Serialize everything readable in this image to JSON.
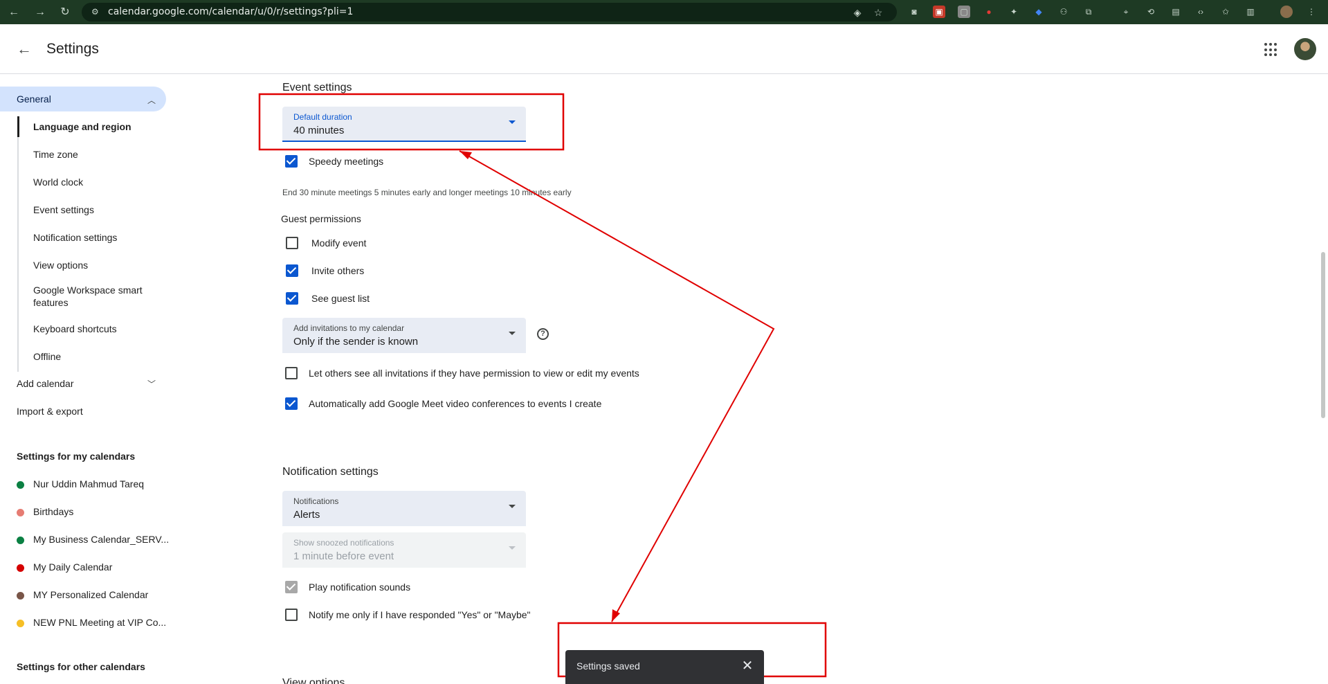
{
  "browser": {
    "url": "calendar.google.com/calendar/u/0/r/settings?pli=1"
  },
  "header": {
    "title": "Settings"
  },
  "sidebar": {
    "general_label": "General",
    "general_items": [
      "Language and region",
      "Time zone",
      "World clock",
      "Event settings",
      "Notification settings",
      "View options",
      "Google Workspace smart features",
      "Keyboard shortcuts",
      "Offline"
    ],
    "add_calendar": "Add calendar",
    "import_export": "Import & export",
    "my_calendars_heading": "Settings for my calendars",
    "my_calendars": [
      {
        "name": "Nur Uddin Mahmud Tareq",
        "color": "#0b8043"
      },
      {
        "name": "Birthdays",
        "color": "#e67c73"
      },
      {
        "name": "My Business Calendar_SERV...",
        "color": "#0b8043"
      },
      {
        "name": "My Daily Calendar",
        "color": "#d50000"
      },
      {
        "name": "MY Personalized Calendar",
        "color": "#795548"
      },
      {
        "name": "NEW PNL Meeting at VIP Co...",
        "color": "#f6bf26"
      }
    ],
    "other_calendars_heading": "Settings for other calendars"
  },
  "event_settings": {
    "title": "Event settings",
    "default_duration": {
      "label": "Default duration",
      "value": "40 minutes"
    },
    "speedy_meetings": {
      "label": "Speedy meetings",
      "checked": true
    },
    "speedy_helper": "End 30 minute meetings 5 minutes early and longer meetings 10 minutes early",
    "guest_permissions_heading": "Guest permissions",
    "guest_permissions": [
      {
        "label": "Modify event",
        "checked": false
      },
      {
        "label": "Invite others",
        "checked": true
      },
      {
        "label": "See guest list",
        "checked": true
      }
    ],
    "add_invitations": {
      "label": "Add invitations to my calendar",
      "value": "Only if the sender is known"
    },
    "help_icon": "?",
    "let_others_see": {
      "label": "Let others see all invitations if they have permission to view or edit my events",
      "checked": false
    },
    "auto_meet": {
      "label": "Automatically add Google Meet video conferences to events I create",
      "checked": true
    }
  },
  "notification_settings": {
    "title": "Notification settings",
    "notifications": {
      "label": "Notifications",
      "value": "Alerts"
    },
    "snoozed": {
      "label": "Show snoozed notifications",
      "value": "1 minute before event"
    },
    "play_sounds": {
      "label": "Play notification sounds",
      "checked": true
    },
    "notify_responded": {
      "label": "Notify me only if I have responded \"Yes\" or \"Maybe\"",
      "checked": false
    }
  },
  "view_options_title": "View options",
  "snackbar": {
    "message": "Settings saved"
  },
  "annotation_color": "#e00000"
}
